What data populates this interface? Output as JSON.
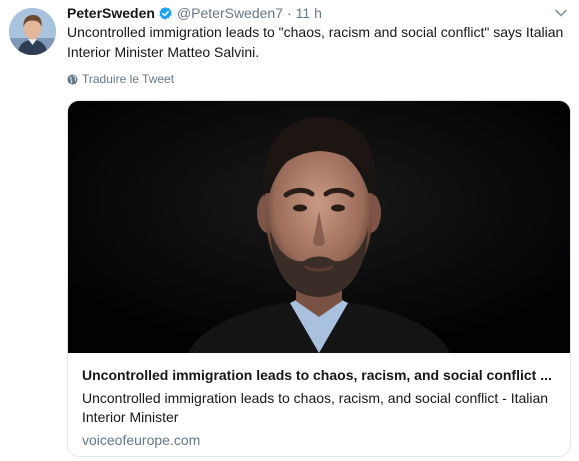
{
  "tweet": {
    "display_name": "PeterSweden",
    "handle": "@PeterSweden7",
    "separator": "·",
    "time": "11 h",
    "text": "Uncontrolled immigration leads to \"chaos, racism and social conflict\" says Italian Interior Minister Matteo Salvini.",
    "translate_label": "Traduire le Tweet",
    "verified": true
  },
  "card": {
    "title": "Uncontrolled immigration leads to chaos, racism, and social conflict ...",
    "description": "Uncontrolled immigration leads to chaos, racism, and social conflict - Italian Interior Minister",
    "domain": "voiceofeurope.com",
    "image_icon": "portrait-photo"
  },
  "icons": {
    "verified": "verified-badge-icon",
    "translate": "globe-icon",
    "menu": "chevron-down-icon"
  },
  "colors": {
    "text": "#14171a",
    "secondary": "#657786",
    "verified": "#1da1f2",
    "border": "#e1e8ed"
  }
}
